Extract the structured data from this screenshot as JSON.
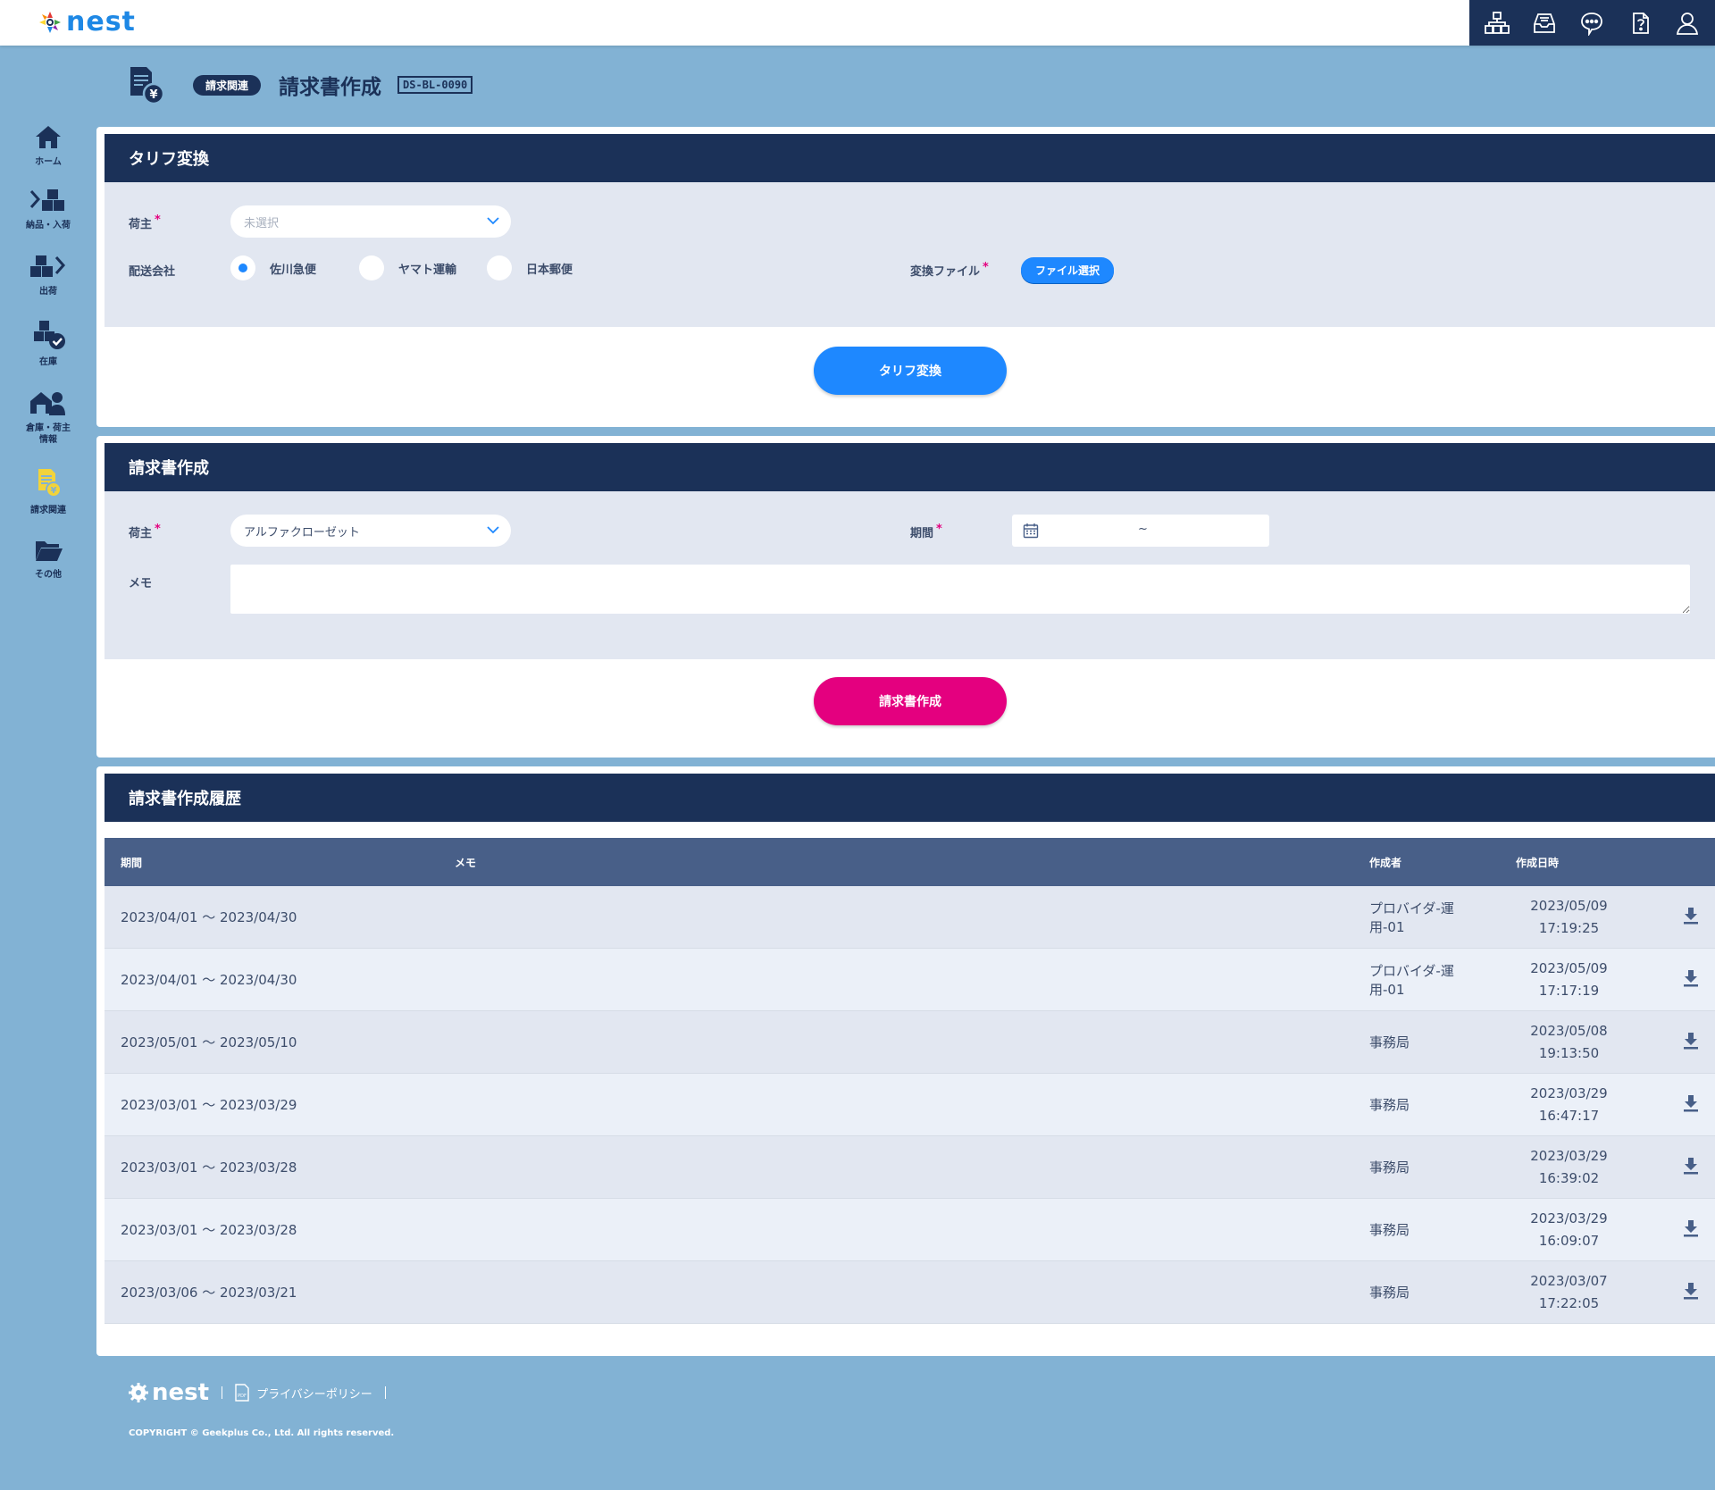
{
  "app": {
    "logo_text": "nest"
  },
  "topbar": {
    "icons": [
      "warehouse-structure-icon",
      "inbox-tray-icon",
      "chat-bubble-icon",
      "help-document-icon",
      "user-account-icon"
    ]
  },
  "sidebar": {
    "items": [
      {
        "label": "ホーム",
        "icon": "home-icon"
      },
      {
        "label": "納品・入荷",
        "icon": "receiving-icon"
      },
      {
        "label": "出荷",
        "icon": "shipping-icon"
      },
      {
        "label": "在庫",
        "icon": "inventory-icon"
      },
      {
        "label_line1": "倉庫・荷主",
        "label_line2": "情報",
        "icon": "warehouse-owner-icon"
      },
      {
        "label": "請求関連",
        "icon": "billing-icon",
        "active": true
      },
      {
        "label": "その他",
        "icon": "folder-icon"
      }
    ]
  },
  "page": {
    "tag": "請求関連",
    "title": "請求書作成",
    "id": "DS-BL-0090"
  },
  "tariff": {
    "title": "タリフ変換",
    "owner_label": "荷主",
    "owner_placeholder": "未選択",
    "carrier_label": "配送会社",
    "carriers": [
      "佐川急便",
      "ヤマト運輸",
      "日本郵便"
    ],
    "selected_carrier": "佐川急便",
    "file_label": "変換ファイル",
    "file_button": "ファイル選択",
    "submit": "タリフ変換"
  },
  "invoice": {
    "title": "請求書作成",
    "owner_label": "荷主",
    "owner_value": "アルファクローゼット",
    "period_label": "期間",
    "period_separator": "~",
    "memo_label": "メモ",
    "memo_value": "",
    "submit": "請求書作成"
  },
  "history": {
    "title": "請求書作成履歴",
    "columns": {
      "period": "期間",
      "memo": "メモ",
      "author": "作成者",
      "created": "作成日時"
    },
    "rows": [
      {
        "period": "2023/04/01 〜 2023/04/30",
        "memo": "",
        "author": "プロバイダ-運用-01",
        "date": "2023/05/09",
        "time": "17:19:25"
      },
      {
        "period": "2023/04/01 〜 2023/04/30",
        "memo": "",
        "author": "プロバイダ-運用-01",
        "date": "2023/05/09",
        "time": "17:17:19"
      },
      {
        "period": "2023/05/01 〜 2023/05/10",
        "memo": "",
        "author": "事務局",
        "date": "2023/05/08",
        "time": "19:13:50"
      },
      {
        "period": "2023/03/01 〜 2023/03/29",
        "memo": "",
        "author": "事務局",
        "date": "2023/03/29",
        "time": "16:47:17"
      },
      {
        "period": "2023/03/01 〜 2023/03/28",
        "memo": "",
        "author": "事務局",
        "date": "2023/03/29",
        "time": "16:39:02"
      },
      {
        "period": "2023/03/01 〜 2023/03/28",
        "memo": "",
        "author": "事務局",
        "date": "2023/03/29",
        "time": "16:09:07"
      },
      {
        "period": "2023/03/06 〜 2023/03/21",
        "memo": "",
        "author": "事務局",
        "date": "2023/03/07",
        "time": "17:22:05"
      }
    ]
  },
  "footer": {
    "logo_text": "nest",
    "privacy": "プライバシーポリシー",
    "copyright": "COPYRIGHT © Geekplus Co., Ltd. All rights reserved."
  },
  "colors": {
    "navy": "#1b3158",
    "bg": "#82b2d4",
    "accent_blue": "#1e88ff",
    "accent_pink": "#e4007f",
    "table_header": "#485f88"
  }
}
